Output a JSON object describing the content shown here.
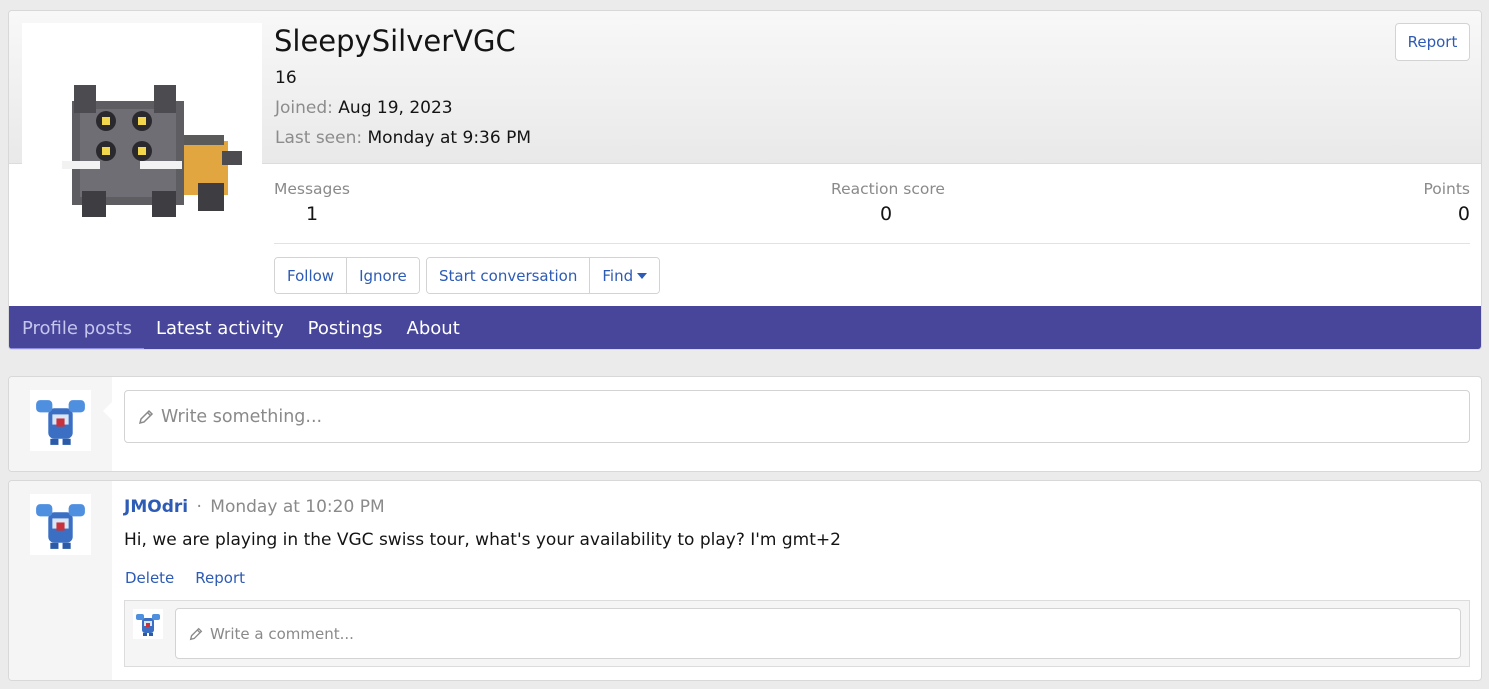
{
  "profile": {
    "username": "SleepySilverVGC",
    "title": "16",
    "joined_label": "Joined:",
    "joined_value": "Aug 19, 2023",
    "last_seen_label": "Last seen:",
    "last_seen_value": "Monday at 9:36 PM",
    "report_label": "Report",
    "stats": {
      "messages_label": "Messages",
      "messages_value": "1",
      "reaction_label": "Reaction score",
      "reaction_value": "0",
      "points_label": "Points",
      "points_value": "0"
    },
    "buttons": {
      "follow": "Follow",
      "ignore": "Ignore",
      "start_conversation": "Start conversation",
      "find": "Find"
    }
  },
  "tabs": [
    {
      "label": "Profile posts",
      "active": true
    },
    {
      "label": "Latest activity",
      "active": false
    },
    {
      "label": "Postings",
      "active": false
    },
    {
      "label": "About",
      "active": false
    }
  ],
  "composer": {
    "placeholder": "Write something..."
  },
  "message": {
    "author": "JMOdri",
    "separator": "·",
    "time": "Monday at 10:20 PM",
    "body": "Hi, we are playing in the VGC swiss tour, what's your availability to play? I'm gmt+2",
    "actions": {
      "delete": "Delete",
      "report": "Report"
    },
    "comment_placeholder": "Write a comment..."
  },
  "colors": {
    "nav_bar": "#47469a",
    "link": "#2d5bb5",
    "muted": "#8a8a8a"
  },
  "icons": {
    "pencil": "pencil-icon",
    "caret": "chevron-down-icon"
  }
}
